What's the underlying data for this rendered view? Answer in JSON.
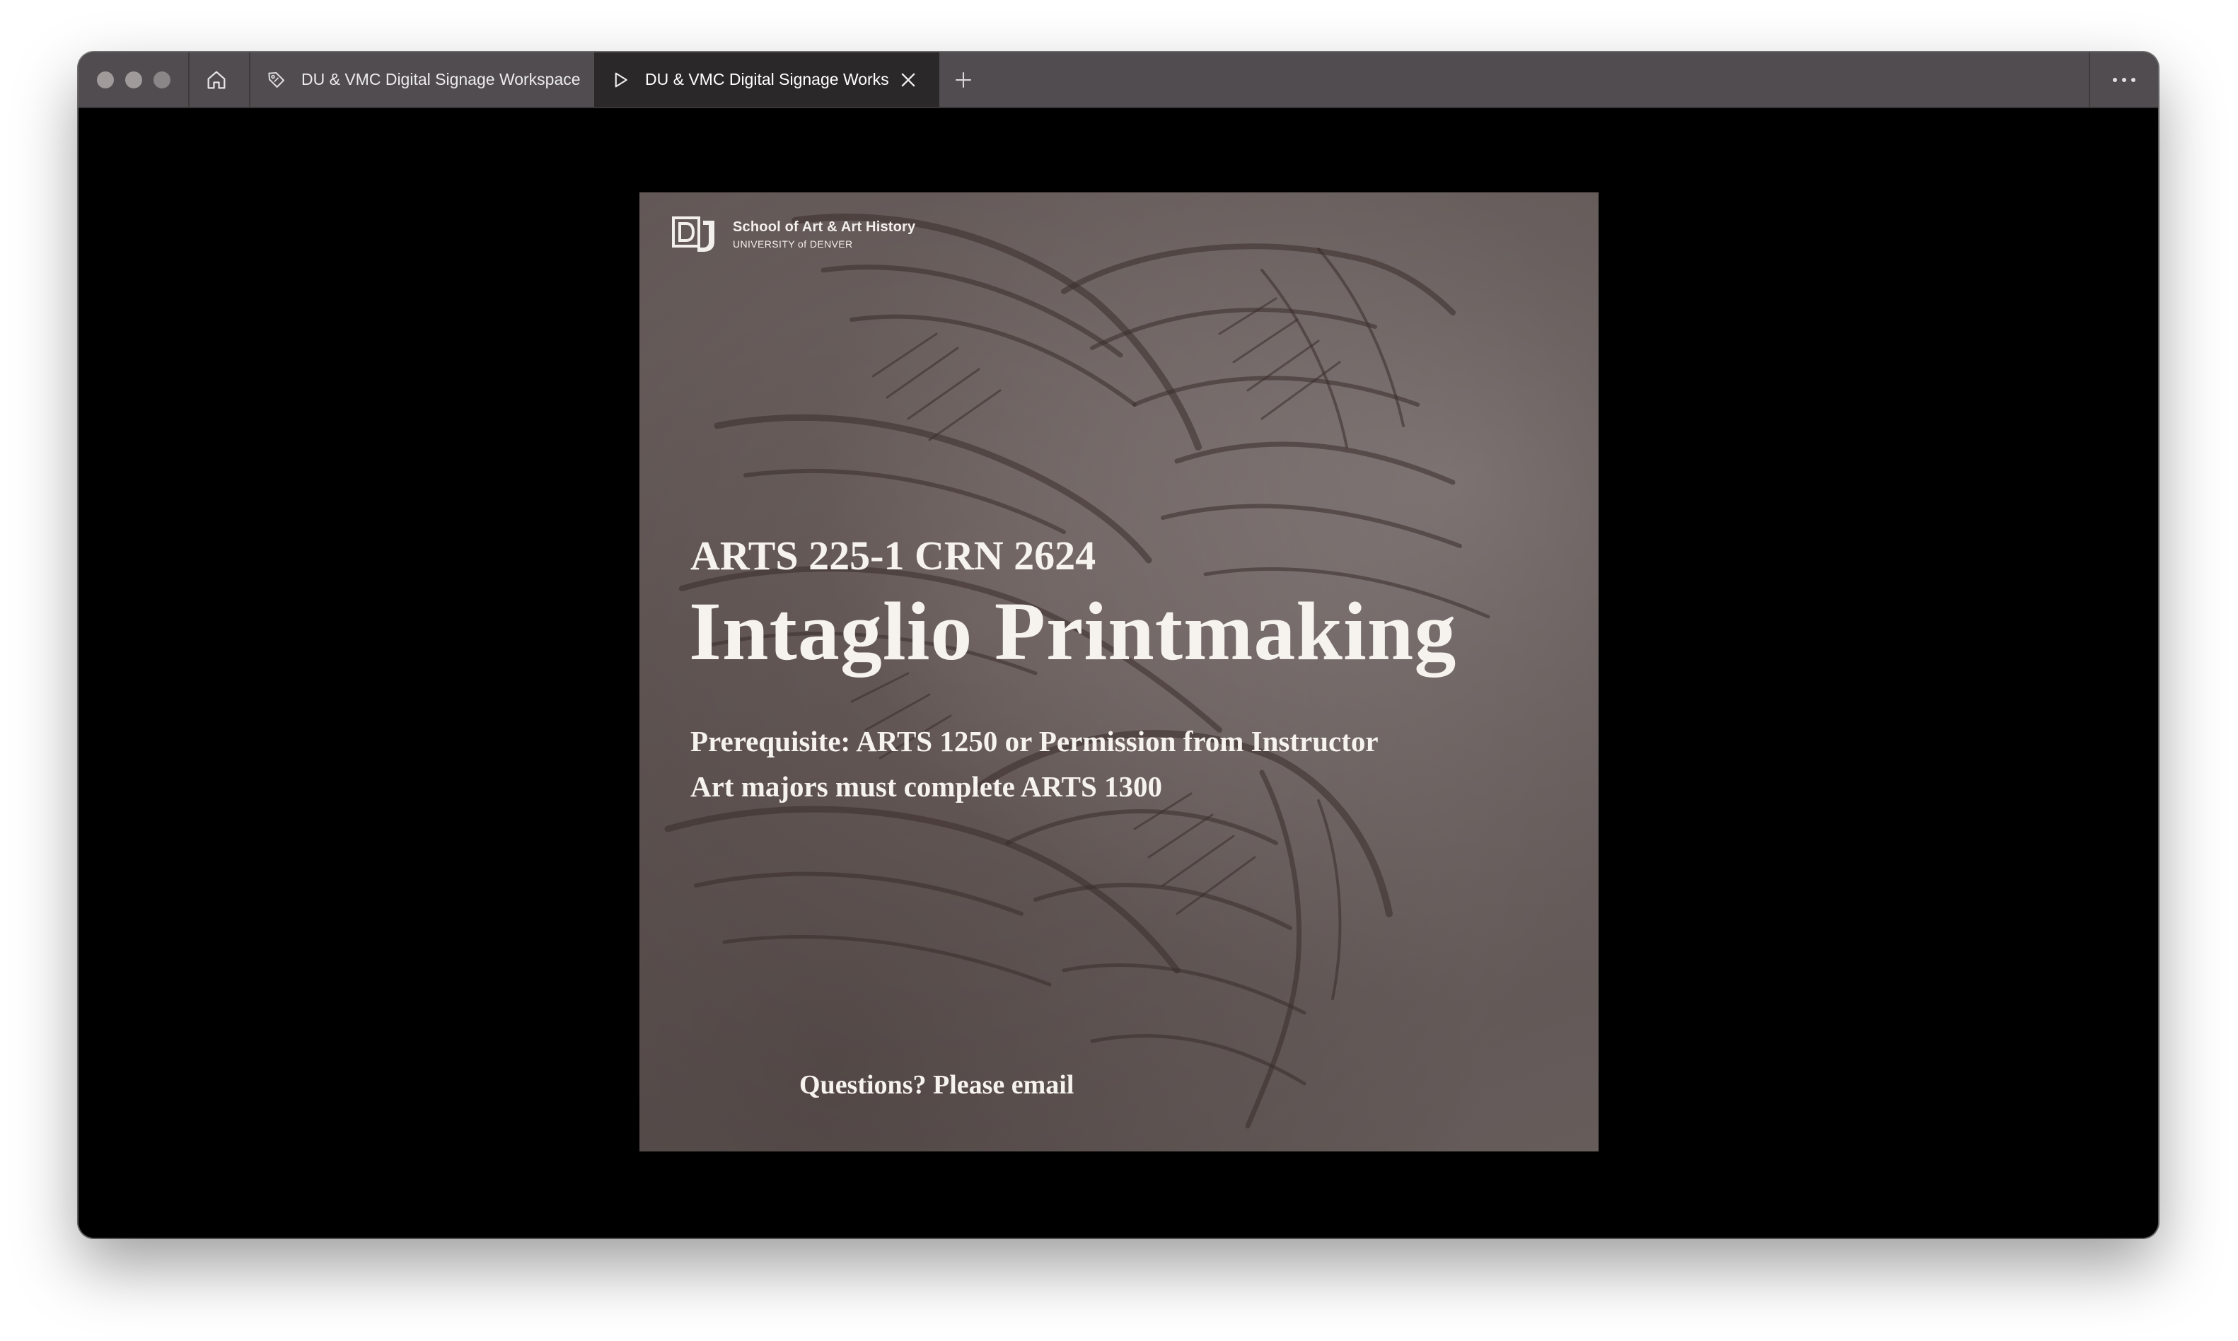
{
  "browser": {
    "tabs": [
      {
        "label": "DU & VMC Digital Signage Workspace",
        "icon": "tag-icon",
        "active": false
      },
      {
        "label": "DU & VMC Digital Signage Workspace",
        "icon": "play-icon",
        "active": true
      }
    ],
    "home_icon": "home-icon",
    "new_tab_icon": "plus-icon",
    "close_icon": "close-icon",
    "more_icon": "more-horizontal-icon"
  },
  "poster": {
    "logo": {
      "mark": "DU",
      "school": "School of Art & Art History",
      "university": "UNIVERSITY of DENVER"
    },
    "course_code": "ARTS 225-1 CRN 2624",
    "course_title": "Intaglio Printmaking",
    "prerequisite": "Prerequisite: ARTS 1250 or Permission from Instructor",
    "majors_note": "Art majors must complete ARTS 1300",
    "questions": "Questions? Please email",
    "colors": {
      "background": "#6f6361",
      "text": "#f6f2ee",
      "etching": "#3b2e2b"
    }
  }
}
